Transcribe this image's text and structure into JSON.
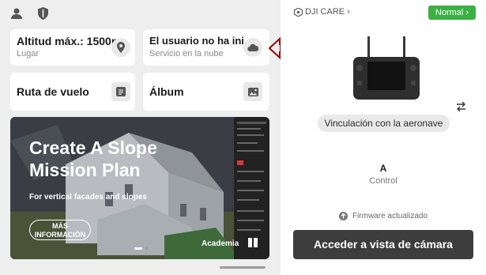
{
  "header": {
    "user_icon": "user-icon",
    "shield_icon": "shield-icon"
  },
  "cards": {
    "altitude": {
      "title": "Altitud máx.: 1500m",
      "subtitle": "Lugar",
      "icon": "location-pin-icon"
    },
    "cloud": {
      "title": "El usuario no ha ini",
      "subtitle": "Servicio en la nube",
      "icon": "cloud-icon"
    },
    "route": {
      "title": "Ruta de vuelo",
      "icon": "route-icon"
    },
    "album": {
      "title": "Álbum",
      "icon": "image-icon"
    }
  },
  "banner": {
    "title": "Create A Slope Mission Plan",
    "subtitle": "For vertical facades and slopes",
    "button": "MÁS INFORMACIÓN",
    "footer": "Academia"
  },
  "right": {
    "care_label": "DJI CARE",
    "normal_button": "Normal",
    "link_button": "Vinculación con la aeronave",
    "device_letter": "A",
    "device_label": "Control",
    "firmware_text": "Firmware actualizado",
    "camera_button": "Acceder a vista de cámara"
  },
  "colors": {
    "accent_green": "#3cb043",
    "annotation_red": "#8b0a0a",
    "dark_button": "#3d3d3d"
  }
}
